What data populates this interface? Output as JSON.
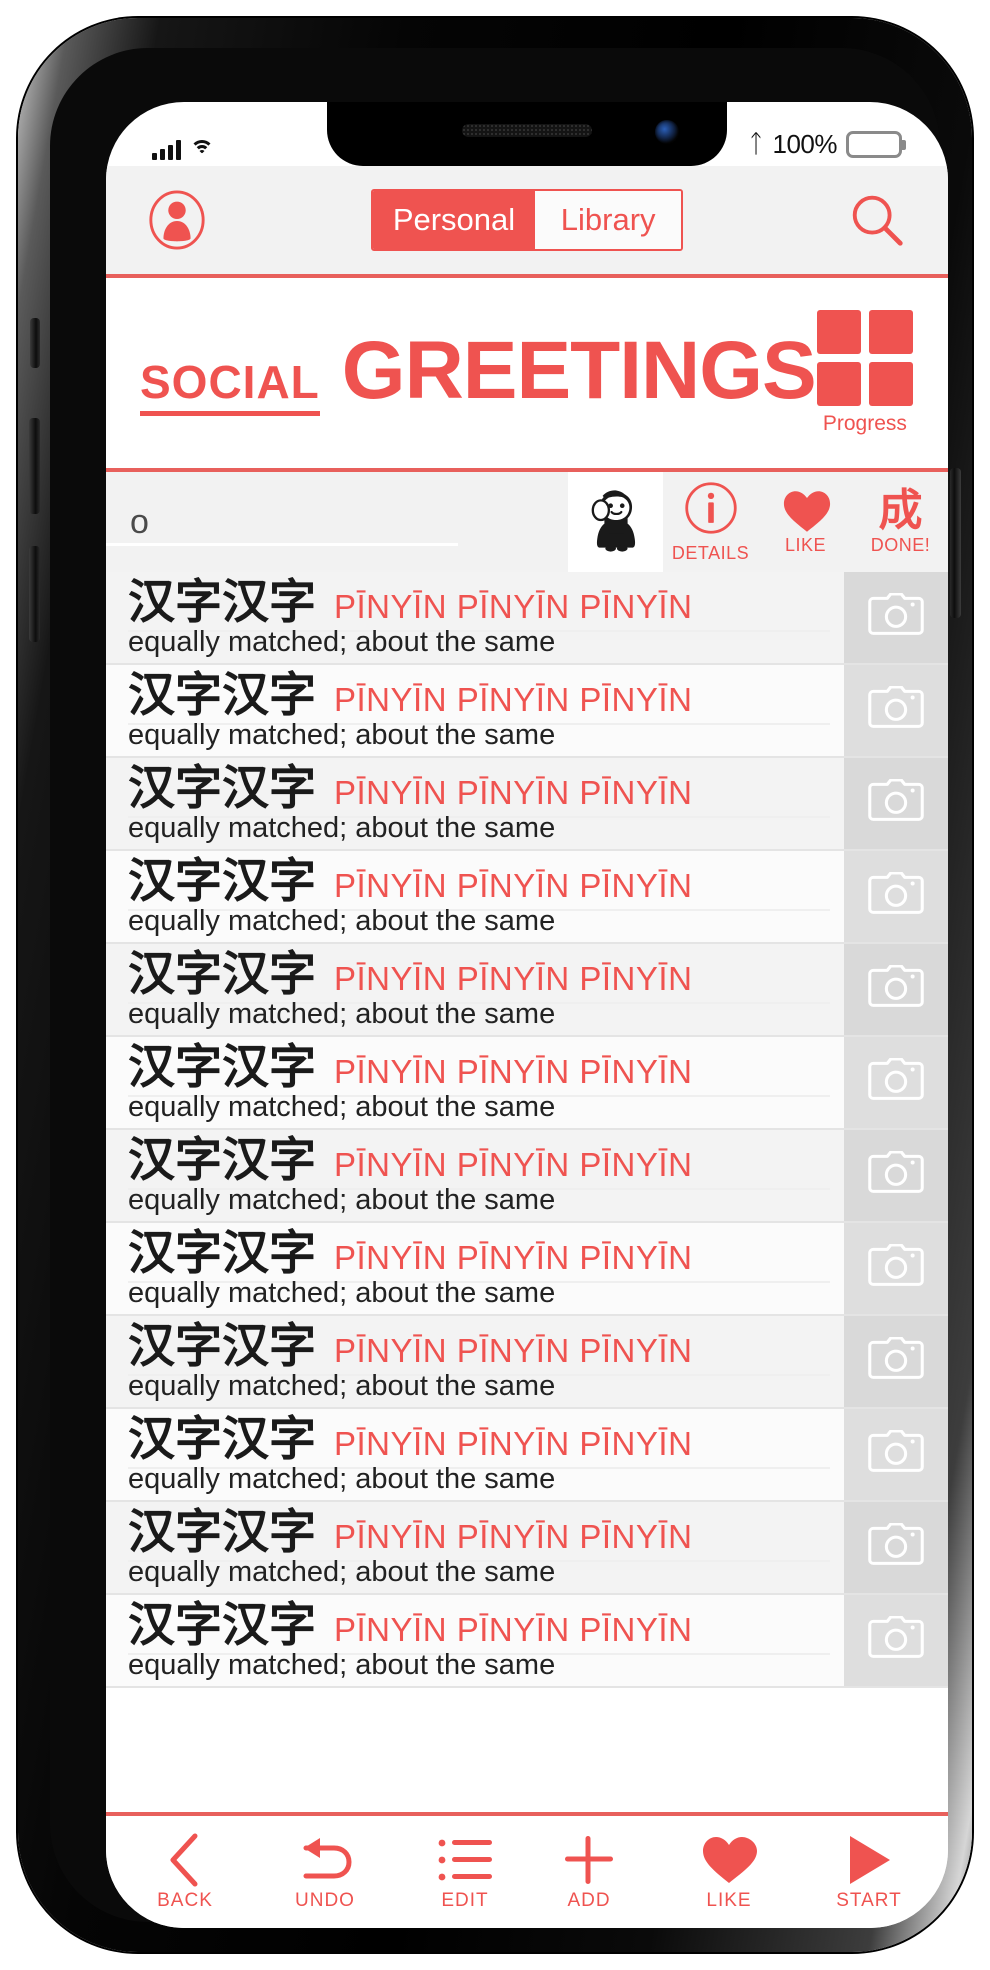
{
  "status_bar": {
    "bluetooth_icon": "bluetooth-icon",
    "battery_percent": "100%",
    "signal_icon": "cellular-signal-icon",
    "wifi_icon": "wifi-icon",
    "battery_icon": "battery-full-icon"
  },
  "nav": {
    "account_icon": "account-avatar-icon",
    "search_icon": "search-icon",
    "segments": [
      {
        "label": "Personal",
        "selected": true
      },
      {
        "label": "Library",
        "selected": false
      }
    ]
  },
  "title": {
    "kicker": "SOCIAL",
    "main": "GREETINGS",
    "progress_label": "Progress",
    "progress_icon": "four-squares-grid-icon"
  },
  "column_header": {
    "search_value": "o",
    "listen_icon": "listening-person-icon",
    "details_label": "DETAILS",
    "details_icon": "info-circle-icon",
    "like_label": "LIKE",
    "like_icon": "heart-icon",
    "done_label": "DONE!",
    "done_glyph": "成"
  },
  "list": {
    "camera_icon": "camera-icon",
    "rows": [
      {
        "hanzi": "汉字汉字",
        "pinyin": "PĪNYĪN PĪNYĪN PĪNYĪN",
        "gloss": "equally matched; about the same"
      },
      {
        "hanzi": "汉字汉字",
        "pinyin": "PĪNYĪN PĪNYĪN PĪNYĪN",
        "gloss": "equally matched; about the same"
      },
      {
        "hanzi": "汉字汉字",
        "pinyin": "PĪNYĪN PĪNYĪN PĪNYĪN",
        "gloss": "equally matched; about the same"
      },
      {
        "hanzi": "汉字汉字",
        "pinyin": "PĪNYĪN PĪNYĪN PĪNYĪN",
        "gloss": "equally matched; about the same"
      },
      {
        "hanzi": "汉字汉字",
        "pinyin": "PĪNYĪN PĪNYĪN PĪNYĪN",
        "gloss": "equally matched; about the same"
      },
      {
        "hanzi": "汉字汉字",
        "pinyin": "PĪNYĪN PĪNYĪN PĪNYĪN",
        "gloss": "equally matched; about the same"
      },
      {
        "hanzi": "汉字汉字",
        "pinyin": "PĪNYĪN PĪNYĪN PĪNYĪN",
        "gloss": "equally matched; about the same"
      },
      {
        "hanzi": "汉字汉字",
        "pinyin": "PĪNYĪN PĪNYĪN PĪNYĪN",
        "gloss": "equally matched; about the same"
      },
      {
        "hanzi": "汉字汉字",
        "pinyin": "PĪNYĪN PĪNYĪN PĪNYĪN",
        "gloss": "equally matched; about the same"
      },
      {
        "hanzi": "汉字汉字",
        "pinyin": "PĪNYĪN PĪNYĪN PĪNYĪN",
        "gloss": "equally matched; about the same"
      },
      {
        "hanzi": "汉字汉字",
        "pinyin": "PĪNYĪN PĪNYĪN PĪNYĪN",
        "gloss": "equally matched; about the same"
      },
      {
        "hanzi": "汉字汉字",
        "pinyin": "PĪNYĪN PĪNYĪN PĪNYĪN",
        "gloss": "equally matched; about the same"
      }
    ]
  },
  "toolbar": {
    "back_label": "BACK",
    "undo_label": "UNDO",
    "edit_label": "EDIT",
    "add_label": "ADD",
    "like_label": "LIKE",
    "start_label": "START"
  },
  "colors": {
    "accent": "#ef5350",
    "rule": "#e8605c",
    "chrome": "#f2f2f2",
    "row_alt": "#f3f3f3"
  }
}
